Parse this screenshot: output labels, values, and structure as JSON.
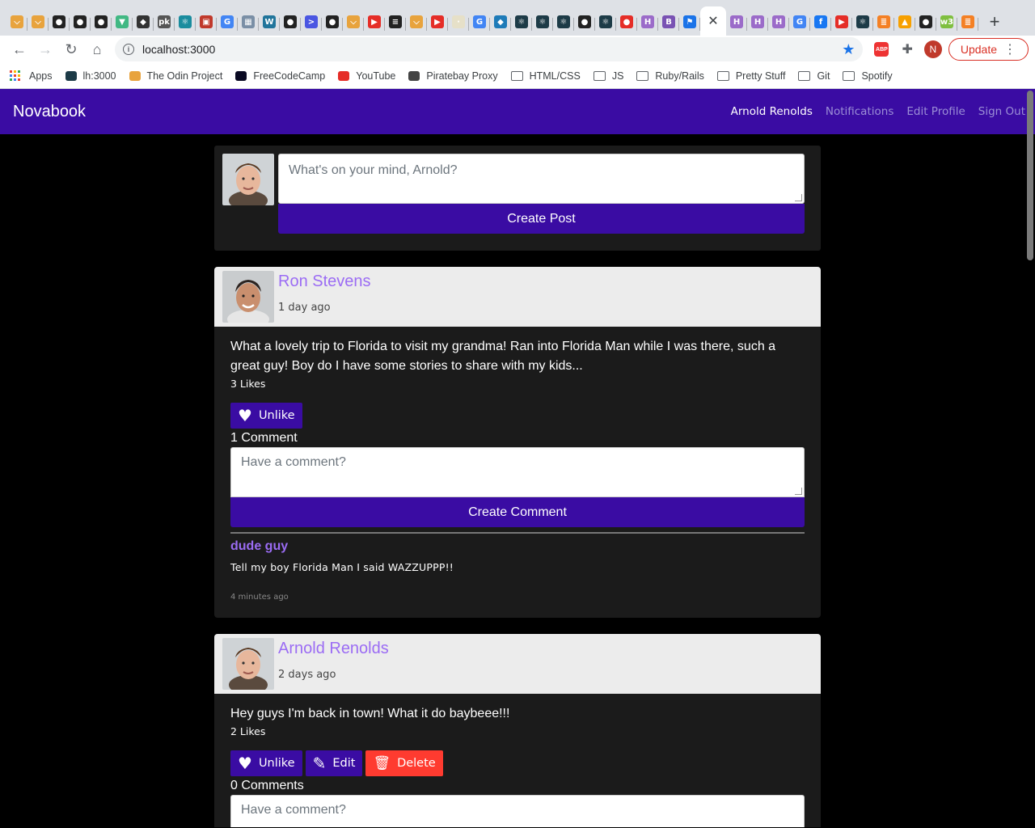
{
  "browser": {
    "tab_favicons": [
      {
        "name": "odin-favicon-icon",
        "color": "#e8a33d",
        "glyph": "⌵"
      },
      {
        "name": "odin-favicon-icon",
        "color": "#e8a33d",
        "glyph": "⌵"
      },
      {
        "name": "github-favicon-icon",
        "color": "#222",
        "glyph": "●"
      },
      {
        "name": "github-favicon-icon",
        "color": "#222",
        "glyph": "●"
      },
      {
        "name": "github-favicon-icon",
        "color": "#222",
        "glyph": "●"
      },
      {
        "name": "vue-favicon-icon",
        "color": "#41b883",
        "glyph": "▼"
      },
      {
        "name": "app-favicon-icon",
        "color": "#333",
        "glyph": "◆"
      },
      {
        "name": "pk-favicon-icon",
        "color": "#555",
        "glyph": "pk"
      },
      {
        "name": "react-favicon-icon",
        "color": "#1a8c9e",
        "glyph": "⚛"
      },
      {
        "name": "profile-favicon-icon",
        "color": "#c0392b",
        "glyph": "▣"
      },
      {
        "name": "google-favicon-icon",
        "color": "#4285f4",
        "glyph": "G"
      },
      {
        "name": "photo-favicon-icon",
        "color": "#7a8fa6",
        "glyph": "▦"
      },
      {
        "name": "wordpress-favicon-icon",
        "color": "#21759b",
        "glyph": "W"
      },
      {
        "name": "github-favicon-icon",
        "color": "#222",
        "glyph": "●"
      },
      {
        "name": "terminal-favicon-icon",
        "color": "#4a56e2",
        "glyph": ">"
      },
      {
        "name": "github-favicon-icon",
        "color": "#222",
        "glyph": "●"
      },
      {
        "name": "odin-favicon-icon",
        "color": "#e8a33d",
        "glyph": "⌵"
      },
      {
        "name": "youtube-favicon-icon",
        "color": "#e52d27",
        "glyph": "▶"
      },
      {
        "name": "notes-favicon-icon",
        "color": "#222",
        "glyph": "≡"
      },
      {
        "name": "odin-favicon-icon",
        "color": "#e8a33d",
        "glyph": "⌵"
      },
      {
        "name": "youtube-favicon-icon",
        "color": "#e52d27",
        "glyph": "▶"
      },
      {
        "name": "blank-favicon-icon",
        "color": "#e6e0c8",
        "glyph": "·"
      },
      {
        "name": "google-favicon-icon",
        "color": "#4285f4",
        "glyph": "G"
      },
      {
        "name": "edu-favicon-icon",
        "color": "#1e7bb8",
        "glyph": "◆"
      },
      {
        "name": "react-favicon-icon",
        "color": "#1d3b47",
        "glyph": "⚛"
      },
      {
        "name": "react-favicon-icon",
        "color": "#1d3b47",
        "glyph": "⚛"
      },
      {
        "name": "react-favicon-icon",
        "color": "#1d3b47",
        "glyph": "⚛"
      },
      {
        "name": "github-favicon-icon",
        "color": "#222",
        "glyph": "●"
      },
      {
        "name": "react-favicon-icon",
        "color": "#1d3b47",
        "glyph": "⚛"
      },
      {
        "name": "record-favicon-icon",
        "color": "#e52d27",
        "glyph": "●"
      },
      {
        "name": "heroku-favicon-icon",
        "color": "#9b6bc9",
        "glyph": "H"
      },
      {
        "name": "bootstrap-favicon-icon",
        "color": "#7952b3",
        "glyph": "B"
      },
      {
        "name": "flag-favicon-icon",
        "color": "#1a73e8",
        "glyph": "⚑"
      }
    ],
    "tab_favicons_after": [
      {
        "name": "heroku-favicon-icon",
        "color": "#9b6bc9",
        "glyph": "H"
      },
      {
        "name": "heroku-favicon-icon",
        "color": "#9b6bc9",
        "glyph": "H"
      },
      {
        "name": "heroku-favicon-icon",
        "color": "#9b6bc9",
        "glyph": "H"
      },
      {
        "name": "google-favicon-icon",
        "color": "#4285f4",
        "glyph": "G"
      },
      {
        "name": "facebook-favicon-icon",
        "color": "#1877f2",
        "glyph": "f"
      },
      {
        "name": "youtube-favicon-icon",
        "color": "#e52d27",
        "glyph": "▶"
      },
      {
        "name": "react-favicon-icon",
        "color": "#1d3b47",
        "glyph": "⚛"
      },
      {
        "name": "stackoverflow-favicon-icon",
        "color": "#f48024",
        "glyph": "≣"
      },
      {
        "name": "blocks-favicon-icon",
        "color": "#f7a000",
        "glyph": "▲"
      },
      {
        "name": "github-favicon-icon",
        "color": "#222",
        "glyph": "●"
      },
      {
        "name": "w3c-favicon-icon",
        "color": "#7fbf3f",
        "glyph": "w3"
      },
      {
        "name": "stackoverflow-favicon-icon",
        "color": "#f48024",
        "glyph": "≣"
      }
    ],
    "active_tab_close": "✕",
    "new_tab": "+",
    "url": "localhost:3000",
    "update_label": "Update",
    "profile_initial": "N",
    "bookmarks": [
      {
        "name": "bookmark-apps",
        "label": "Apps",
        "type": "apps"
      },
      {
        "name": "bookmark-lh3000",
        "label": "lh:3000",
        "type": "react"
      },
      {
        "name": "bookmark-odin-project",
        "label": "The Odin Project",
        "type": "odin"
      },
      {
        "name": "bookmark-freecodecamp",
        "label": "FreeCodeCamp",
        "type": "fcc"
      },
      {
        "name": "bookmark-youtube",
        "label": "YouTube",
        "type": "youtube"
      },
      {
        "name": "bookmark-piratebay",
        "label": "Piratebay Proxy",
        "type": "pirate"
      },
      {
        "name": "bookmark-folder-html-css",
        "label": "HTML/CSS",
        "type": "folder"
      },
      {
        "name": "bookmark-folder-js",
        "label": "JS",
        "type": "folder"
      },
      {
        "name": "bookmark-folder-ruby-rails",
        "label": "Ruby/Rails",
        "type": "folder"
      },
      {
        "name": "bookmark-folder-pretty-stuff",
        "label": "Pretty Stuff",
        "type": "folder"
      },
      {
        "name": "bookmark-folder-git",
        "label": "Git",
        "type": "folder"
      },
      {
        "name": "bookmark-folder-spotify",
        "label": "Spotify",
        "type": "folder"
      }
    ]
  },
  "app": {
    "brand": "Novabook",
    "nav": {
      "user": "Arnold Renolds",
      "notifications": "Notifications",
      "edit_profile": "Edit Profile",
      "sign_out": "Sign Out"
    },
    "composer": {
      "placeholder": "What's on your mind, Arnold?",
      "button": "Create Post"
    },
    "posts": [
      {
        "author": "Ron Stevens",
        "time": "1 day ago",
        "text": "What a lovely trip to Florida to visit my grandma! Ran into Florida Man while I was there, such a great guy! Boy do I have some stories to share with my kids...",
        "likes": "3 Likes",
        "unlike_label": "Unlike",
        "comment_count": "1 Comment",
        "comment_placeholder": "Have a comment?",
        "comment_button": "Create Comment",
        "comments": [
          {
            "author": "dude guy",
            "text": "Tell my boy Florida Man I said WAZZUPPP!!",
            "time": "4 minutes ago"
          }
        ]
      },
      {
        "author": "Arnold Renolds",
        "time": "2 days ago",
        "text": "Hey guys I'm back in town! What it do baybeee!!!",
        "likes": "2 Likes",
        "unlike_label": "Unlike",
        "edit_label": "Edit",
        "delete_label": "Delete",
        "comment_count": "0 Comments",
        "comment_placeholder": "Have a comment?"
      }
    ],
    "colors": {
      "primary": "#3a0ca3",
      "author_link": "#9b6cf4",
      "danger": "#ff3b30",
      "card": "#1b1b1b",
      "background": "#000000"
    }
  }
}
